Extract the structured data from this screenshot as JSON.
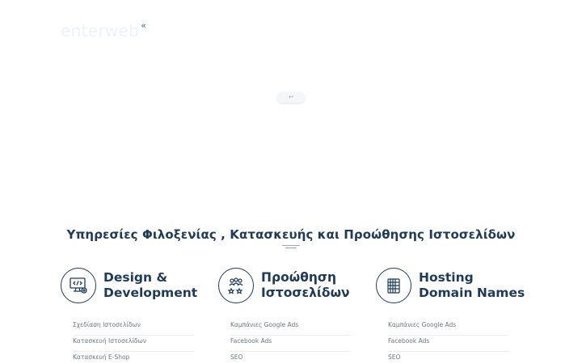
{
  "logo": {
    "text": "enterweb",
    "chevron": "«"
  },
  "scroll_hint": {
    "icon": "↩"
  },
  "headline": "Υπηρεσίες Φιλοξενίας , Κατασκευής και Προώθησης Ιστοσελίδων",
  "columns": [
    {
      "icon": "monitor-code-icon",
      "title_line1": "Design &",
      "title_line2": "Development",
      "items": [
        "Σχεδίαση Ιστοσελίδων",
        "Κατασκευή Ιστοσελίδων",
        "Κατασκευή E-Shop"
      ]
    },
    {
      "icon": "team-icon",
      "title_line1": "Προώθηση",
      "title_line2": "Ιστοσελίδων",
      "items": [
        "Καμπάνιες Google Ads",
        "Facebook Ads",
        "SEO"
      ]
    },
    {
      "icon": "server-icon",
      "title_line1": "Hosting",
      "title_line2": "Domain Names",
      "items": [
        "Καμπάνιες Google Ads",
        "Facebook Ads",
        "SEO"
      ]
    }
  ],
  "colors": {
    "primary": "#1f3a5a",
    "accent": "#2f6fb6",
    "muted": "#6b7785"
  }
}
